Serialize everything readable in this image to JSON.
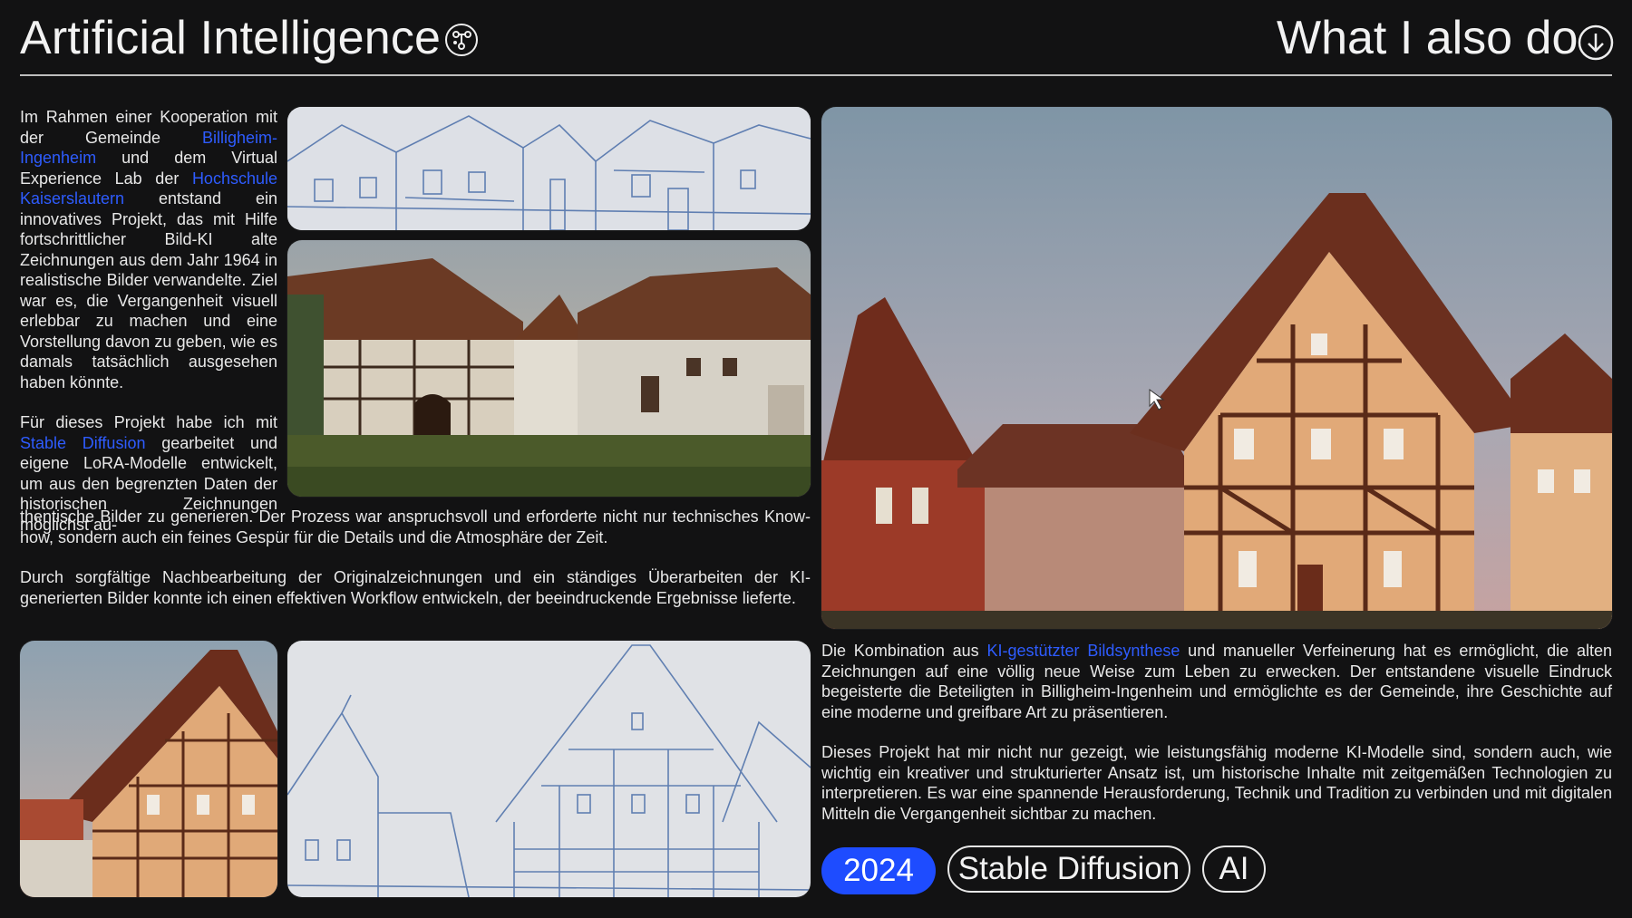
{
  "header": {
    "title": "Artificial Intelligence",
    "title_icon": "ai-network-icon",
    "right_label": "What I also do",
    "right_icon": "arrow-down-circle-icon"
  },
  "left_column": {
    "para1_a": "Im Rahmen einer Kooperation mit der Gemeinde ",
    "para1_link1": "Billigheim-Ingenheim",
    "para1_b": " und dem Virtual Experience Lab der ",
    "para1_link2": "Hochschule Kaiserslautern",
    "para1_c": " entstand ein innovatives Projekt, das mit Hilfe fortschrittlicher Bild-KI alte Zeichnungen aus dem Jahr 1964 in realistische Bilder verwandelte. Ziel war es, die Vergangenheit visuell erlebbar zu machen und eine Vorstellung davon zu geben, wie es damals tatsächlich ausgesehen haben könnte.",
    "para2_a": "Für dieses Projekt habe ich mit ",
    "para2_link": "Stable Diffusion",
    "para2_b": " gearbeitet und eigene LoRA-Modelle entwickelt, um aus den begrenzten Daten der historischen Zeichnungen möglichst au-",
    "para2_cont": "thentische Bilder zu generieren. Der Prozess war anspruchsvoll und erforderte nicht nur technisches Know-how, sondern auch ein feines Gespür für die Details und die Atmosphäre der Zeit.",
    "para3": "Durch sorgfältige Nachbearbeitung der Originalzeichnungen und ein ständiges Überarbeiten der KI-generierten Bilder konnte ich einen effektiven Workflow entwickeln, der beeindruckende Ergebnisse lieferte."
  },
  "right_column": {
    "para1_a": "Die Kombination aus ",
    "para1_link": "KI-gestützter Bildsynthese",
    "para1_b": " und manueller Verfeinerung hat es ermöglicht, die alten Zeichnungen auf eine völlig neue Weise zum Leben zu erwecken. Der entstandene visuelle Eindruck begeisterte die Beteiligten in Billigheim-Ingenheim und ermöglichte es der Gemeinde, ihre Geschichte auf eine moderne und greifbare Art zu präsentieren.",
    "para2": "Dieses Projekt hat mir nicht nur gezeigt, wie leistungsfähig moderne KI-Modelle sind, sondern auch, wie wichtig ein kreativer und strukturierter Ansatz ist, um historische Inhalte mit zeitgemäßen Technologien zu interpretieren. Es war eine spannende Herausforderung, Technik und Tradition zu verbinden und mit digitalen Mitteln die Vergangenheit sichtbar zu machen."
  },
  "tags": [
    "2024",
    "Stable Diffusion",
    "AI"
  ],
  "colors": {
    "background": "#121213",
    "link": "#2e5cff",
    "tag_filled": "#1e4cff",
    "text": "#e8e8e8"
  }
}
